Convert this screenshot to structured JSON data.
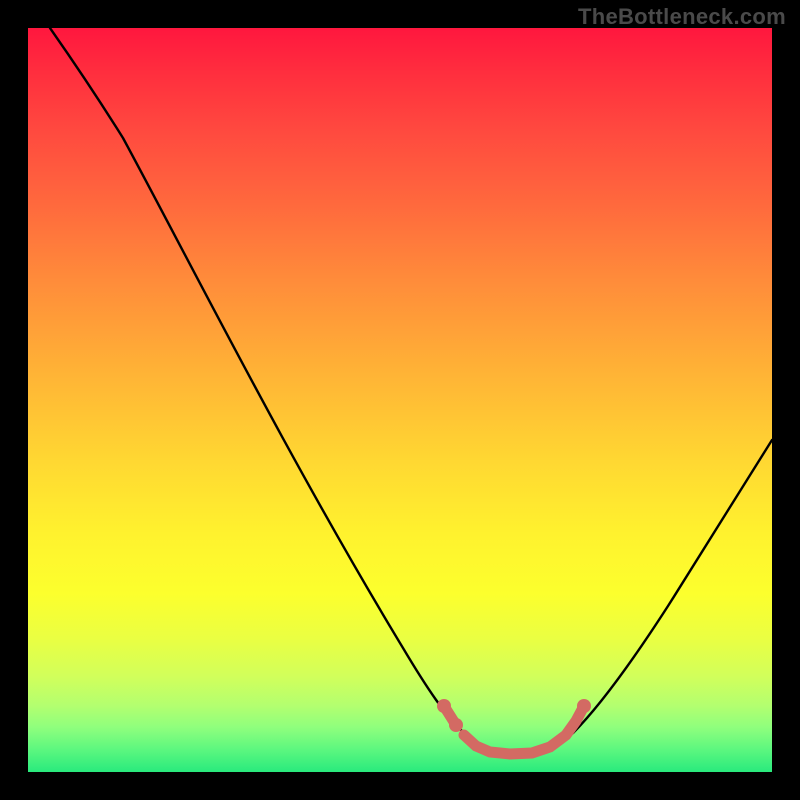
{
  "watermark": "TheBottleneck.com",
  "chart_data": {
    "type": "line",
    "title": "",
    "xlabel": "",
    "ylabel": "",
    "xlim": [
      0,
      100
    ],
    "ylim": [
      0,
      100
    ],
    "grid": false,
    "legend": false,
    "background_gradient": {
      "top_color": "#ff173e",
      "mid_color": "#fff22e",
      "bottom_color": "#29ea7d"
    },
    "series": [
      {
        "name": "bottleneck-curve",
        "color": "#000000",
        "x": [
          3,
          10,
          20,
          30,
          40,
          50,
          55,
          58,
          62,
          66,
          70,
          74,
          80,
          86,
          92,
          100
        ],
        "y": [
          100,
          88,
          72,
          55,
          38,
          21,
          12,
          6,
          3,
          2,
          2,
          3,
          8,
          19,
          32,
          50
        ]
      },
      {
        "name": "optimal-zone-marker",
        "color": "#d36a63",
        "x": [
          55,
          58,
          60,
          63,
          66,
          69,
          72,
          74
        ],
        "y": [
          11,
          6,
          3,
          2,
          2,
          2,
          4,
          8
        ]
      }
    ]
  }
}
